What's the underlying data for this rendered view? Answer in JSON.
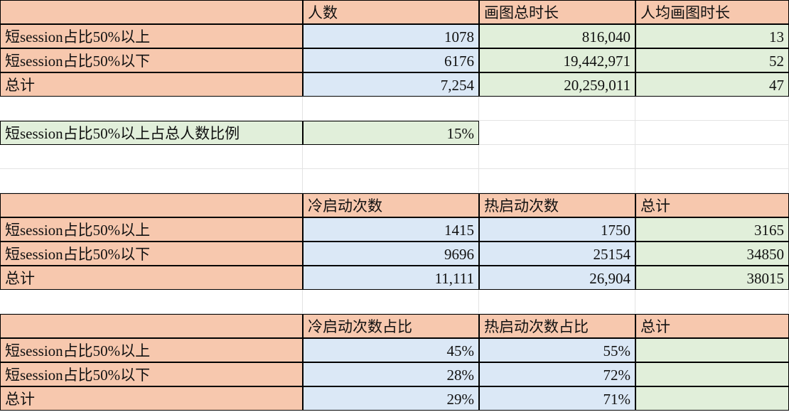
{
  "colors": {
    "orange": "#f7c8ae",
    "blue": "#dbe8f6",
    "green": "#e1efda",
    "white": "#ffffff"
  },
  "rows": [
    {
      "cells": [
        {
          "text": "",
          "c": "orange",
          "a": "txt"
        },
        {
          "text": "人数",
          "c": "orange",
          "a": "txt"
        },
        {
          "text": "画图总时长",
          "c": "orange",
          "a": "txt"
        },
        {
          "text": "人均画图时长",
          "c": "orange",
          "a": "txt"
        }
      ]
    },
    {
      "cells": [
        {
          "text": "短session占比50%以上",
          "c": "orange",
          "a": "txt"
        },
        {
          "text": "1078",
          "c": "blue",
          "a": "num"
        },
        {
          "text": "816,040",
          "c": "green",
          "a": "num"
        },
        {
          "text": "13",
          "c": "green",
          "a": "num"
        }
      ]
    },
    {
      "cells": [
        {
          "text": "短session占比50%以下",
          "c": "orange",
          "a": "txt"
        },
        {
          "text": "6176",
          "c": "blue",
          "a": "num"
        },
        {
          "text": "19,442,971",
          "c": "green",
          "a": "num"
        },
        {
          "text": "52",
          "c": "green",
          "a": "num"
        }
      ]
    },
    {
      "cells": [
        {
          "text": "总计",
          "c": "orange",
          "a": "txt"
        },
        {
          "text": "7,254",
          "c": "blue",
          "a": "num"
        },
        {
          "text": "20,259,011",
          "c": "green",
          "a": "num"
        },
        {
          "text": "47",
          "c": "green",
          "a": "num"
        }
      ]
    },
    {
      "cells": [
        {
          "text": "",
          "c": "empty",
          "a": "txt"
        },
        {
          "text": "",
          "c": "empty",
          "a": "txt"
        },
        {
          "text": "",
          "c": "empty",
          "a": "txt"
        },
        {
          "text": "",
          "c": "empty",
          "a": "txt"
        }
      ]
    },
    {
      "cells": [
        {
          "text": "短session占比50%以上占总人数比例",
          "c": "green",
          "a": "txt"
        },
        {
          "text": "15%",
          "c": "green",
          "a": "num"
        },
        {
          "text": "",
          "c": "empty",
          "a": "txt"
        },
        {
          "text": "",
          "c": "empty",
          "a": "txt"
        }
      ]
    },
    {
      "cells": [
        {
          "text": "",
          "c": "empty",
          "a": "txt"
        },
        {
          "text": "",
          "c": "empty",
          "a": "txt"
        },
        {
          "text": "",
          "c": "empty",
          "a": "txt"
        },
        {
          "text": "",
          "c": "empty",
          "a": "txt"
        }
      ]
    },
    {
      "cells": [
        {
          "text": "",
          "c": "empty",
          "a": "txt"
        },
        {
          "text": "",
          "c": "empty",
          "a": "txt"
        },
        {
          "text": "",
          "c": "empty",
          "a": "txt"
        },
        {
          "text": "",
          "c": "empty",
          "a": "txt"
        }
      ]
    },
    {
      "cells": [
        {
          "text": "",
          "c": "orange",
          "a": "txt"
        },
        {
          "text": "冷启动次数",
          "c": "orange",
          "a": "txt"
        },
        {
          "text": "热启动次数",
          "c": "orange",
          "a": "txt"
        },
        {
          "text": "总计",
          "c": "orange",
          "a": "txt"
        }
      ]
    },
    {
      "cells": [
        {
          "text": "短session占比50%以上",
          "c": "orange",
          "a": "txt"
        },
        {
          "text": "1415",
          "c": "blue",
          "a": "num"
        },
        {
          "text": "1750",
          "c": "blue",
          "a": "num"
        },
        {
          "text": "3165",
          "c": "green",
          "a": "num"
        }
      ]
    },
    {
      "cells": [
        {
          "text": "短session占比50%以下",
          "c": "orange",
          "a": "txt"
        },
        {
          "text": "9696",
          "c": "blue",
          "a": "num"
        },
        {
          "text": "25154",
          "c": "blue",
          "a": "num"
        },
        {
          "text": "34850",
          "c": "green",
          "a": "num"
        }
      ]
    },
    {
      "cells": [
        {
          "text": "总计",
          "c": "orange",
          "a": "txt"
        },
        {
          "text": "11,111",
          "c": "blue",
          "a": "num"
        },
        {
          "text": "26,904",
          "c": "blue",
          "a": "num"
        },
        {
          "text": "38015",
          "c": "green",
          "a": "num"
        }
      ]
    },
    {
      "cells": [
        {
          "text": "",
          "c": "empty",
          "a": "txt"
        },
        {
          "text": "",
          "c": "empty",
          "a": "txt"
        },
        {
          "text": "",
          "c": "empty",
          "a": "txt"
        },
        {
          "text": "",
          "c": "empty",
          "a": "txt"
        }
      ]
    },
    {
      "cells": [
        {
          "text": "",
          "c": "orange",
          "a": "txt"
        },
        {
          "text": "冷启动次数占比",
          "c": "orange",
          "a": "txt"
        },
        {
          "text": "热启动次数占比",
          "c": "orange",
          "a": "txt"
        },
        {
          "text": "总计",
          "c": "orange",
          "a": "txt"
        }
      ]
    },
    {
      "cells": [
        {
          "text": "短session占比50%以上",
          "c": "orange",
          "a": "txt"
        },
        {
          "text": "45%",
          "c": "blue",
          "a": "num"
        },
        {
          "text": "55%",
          "c": "blue",
          "a": "num"
        },
        {
          "text": "",
          "c": "green",
          "a": "num"
        }
      ]
    },
    {
      "cells": [
        {
          "text": "短session占比50%以下",
          "c": "orange",
          "a": "txt"
        },
        {
          "text": "28%",
          "c": "blue",
          "a": "num"
        },
        {
          "text": "72%",
          "c": "blue",
          "a": "num"
        },
        {
          "text": "",
          "c": "green",
          "a": "num"
        }
      ]
    },
    {
      "cells": [
        {
          "text": "总计",
          "c": "orange",
          "a": "txt"
        },
        {
          "text": "29%",
          "c": "blue",
          "a": "num"
        },
        {
          "text": "71%",
          "c": "blue",
          "a": "num"
        },
        {
          "text": "",
          "c": "green",
          "a": "num"
        }
      ]
    }
  ]
}
